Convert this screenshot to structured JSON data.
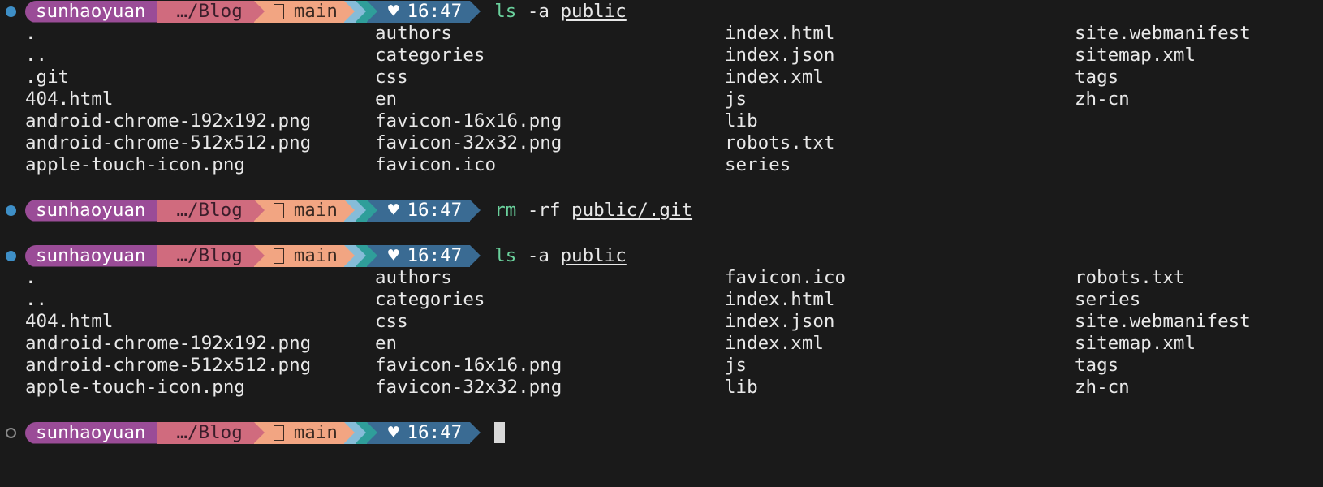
{
  "prompt": {
    "user": "sunhaoyuan",
    "path": "…/Blog",
    "branch": "main",
    "time": "16:47",
    "heart": "♥",
    "colors": {
      "user": "#9a4c97",
      "path": "#d06b7e",
      "git": "#f2a582",
      "stripe1": "#86bcd8",
      "stripe2": "#2f9e9a",
      "time": "#3a6b93",
      "command": "#6ad09c"
    }
  },
  "commands": [
    {
      "bin": "ls",
      "flags": " -a ",
      "arg": "public",
      "status": "done",
      "output_columns": [
        [
          ".",
          "..",
          ".git",
          "404.html",
          "android-chrome-192x192.png",
          "android-chrome-512x512.png",
          "apple-touch-icon.png"
        ],
        [
          "authors",
          "categories",
          "css",
          "en",
          "favicon-16x16.png",
          "favicon-32x32.png",
          "favicon.ico"
        ],
        [
          "index.html",
          "index.json",
          "index.xml",
          "js",
          "lib",
          "robots.txt",
          "series"
        ],
        [
          "site.webmanifest",
          "sitemap.xml",
          "tags",
          "zh-cn"
        ]
      ]
    },
    {
      "bin": "rm",
      "flags": " -rf ",
      "arg": "public/.git",
      "status": "done",
      "output_columns": []
    },
    {
      "bin": "ls",
      "flags": " -a ",
      "arg": "public",
      "status": "done",
      "output_columns": [
        [
          ".",
          "..",
          "404.html",
          "android-chrome-192x192.png",
          "android-chrome-512x512.png",
          "apple-touch-icon.png"
        ],
        [
          "authors",
          "categories",
          "css",
          "en",
          "favicon-16x16.png",
          "favicon-32x32.png"
        ],
        [
          "favicon.ico",
          "index.html",
          "index.json",
          "index.xml",
          "js",
          "lib"
        ],
        [
          "robots.txt",
          "series",
          "site.webmanifest",
          "sitemap.xml",
          "tags",
          "zh-cn"
        ]
      ]
    }
  ]
}
